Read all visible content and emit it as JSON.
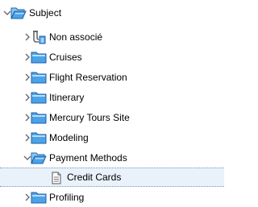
{
  "tree": {
    "root": {
      "label": "Subject",
      "icon": "folder-open-icon",
      "expanded": true
    },
    "children": [
      {
        "label": "Non associé",
        "icon": "unassigned-icon",
        "expanded": false
      },
      {
        "label": "Cruises",
        "icon": "folder-icon",
        "expanded": false
      },
      {
        "label": "Flight Reservation",
        "icon": "folder-icon",
        "expanded": false
      },
      {
        "label": "Itinerary",
        "icon": "folder-icon",
        "expanded": false
      },
      {
        "label": "Mercury Tours Site",
        "icon": "folder-icon",
        "expanded": false
      },
      {
        "label": "Modeling",
        "icon": "folder-icon",
        "expanded": false
      },
      {
        "label": "Payment Methods",
        "icon": "folder-open-icon",
        "expanded": true,
        "children": [
          {
            "label": "Credit Cards",
            "icon": "document-icon",
            "selected": true
          }
        ]
      },
      {
        "label": "Profiling",
        "icon": "folder-icon",
        "expanded": false
      }
    ]
  },
  "colors": {
    "folder_fill": "#4aa3e8",
    "folder_outline": "#1f5fa8",
    "selection_bg": "#e9f2fb",
    "selection_border": "#7a96b8",
    "toggle": "#6b6b6b"
  }
}
